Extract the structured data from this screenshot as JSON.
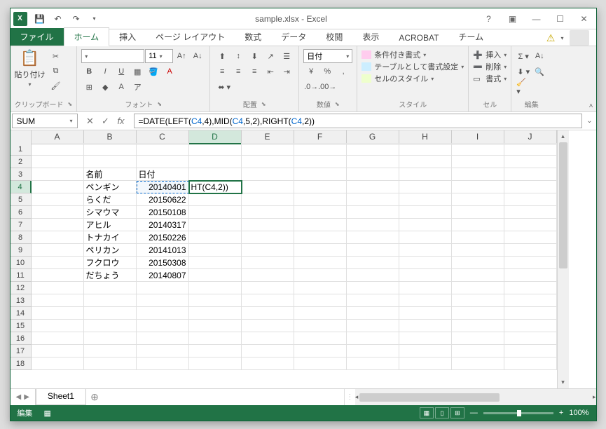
{
  "title": "sample.xlsx - Excel",
  "tabs": {
    "file": "ファイル",
    "home": "ホーム",
    "insert": "挿入",
    "pagelayout": "ページ レイアウト",
    "formulas": "数式",
    "data": "データ",
    "review": "校閲",
    "view": "表示",
    "acrobat": "ACROBAT",
    "team": "チーム"
  },
  "ribbon": {
    "clipboard": {
      "paste": "貼り付け",
      "label": "クリップボード"
    },
    "font": {
      "size": "11",
      "label": "フォント"
    },
    "alignment": {
      "label": "配置"
    },
    "number": {
      "format": "日付",
      "label": "数値"
    },
    "styles": {
      "conditional": "条件付き書式",
      "table": "テーブルとして書式設定",
      "cell": "セルのスタイル",
      "label": "スタイル"
    },
    "cells": {
      "insert": "挿入",
      "delete": "削除",
      "format": "書式",
      "label": "セル"
    },
    "editing": {
      "label": "編集"
    }
  },
  "formula_bar": {
    "name_box": "SUM",
    "formula_prefix": "=DATE(LEFT(",
    "ref1": "C4",
    "mid1": ",4),MID(",
    "ref2": "C4",
    "mid2": ",5,2),RIGHT(",
    "ref3": "C4",
    "mid3": ",2))"
  },
  "columns": [
    "A",
    "B",
    "C",
    "D",
    "E",
    "F",
    "G",
    "H",
    "I",
    "J"
  ],
  "rows": [
    1,
    2,
    3,
    4,
    5,
    6,
    7,
    8,
    9,
    10,
    11,
    12,
    13,
    14,
    15,
    16,
    17,
    18
  ],
  "active_cell": "D4",
  "cells": {
    "B3": "名前",
    "C3": "日付",
    "B4": "ペンギン",
    "C4": "20140401",
    "D4": "HT(C4,2))",
    "B5": "らくだ",
    "C5": "20150622",
    "B6": "シマウマ",
    "C6": "20150108",
    "B7": "アヒル",
    "C7": "20140317",
    "B8": "トナカイ",
    "C8": "20150226",
    "B9": "ペリカン",
    "C9": "20141013",
    "B10": "フクロウ",
    "C10": "20150308",
    "B11": "だちょう",
    "C11": "20140807"
  },
  "sheet_tab": "Sheet1",
  "status": {
    "mode": "編集",
    "zoom": "100%"
  }
}
